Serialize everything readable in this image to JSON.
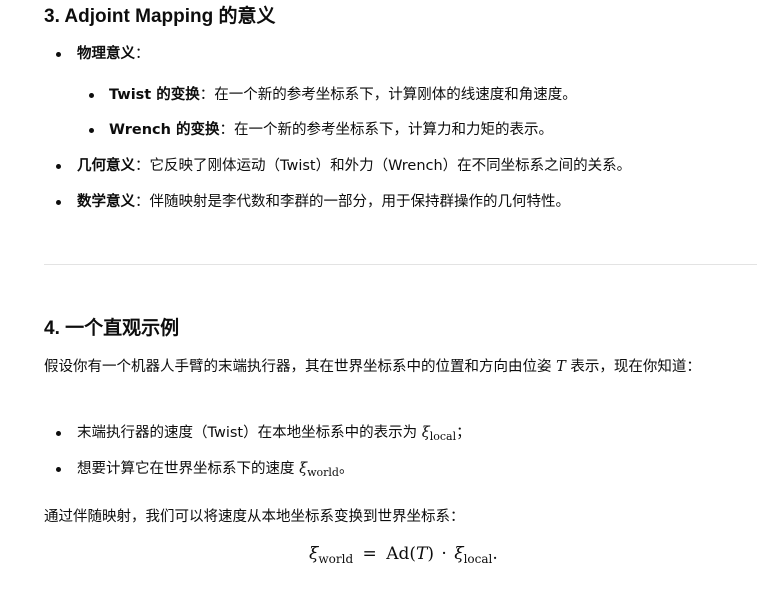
{
  "section3": {
    "heading": "3. Adjoint Mapping 的意义",
    "items": [
      {
        "label": "物理意义",
        "text": "："
      },
      {
        "label": "Twist 的变换",
        "text": "：在一个新的参考坐标系下，计算刚体的线速度和角速度。"
      },
      {
        "label": "Wrench 的变换",
        "text": "：在一个新的参考坐标系下，计算力和力矩的表示。"
      },
      {
        "label": "几何意义",
        "text": "：它反映了刚体运动（Twist）和外力（Wrench）在不同坐标系之间的关系。"
      },
      {
        "label": "数学意义",
        "text": "：伴随映射是李代数和李群的一部分，用于保持群操作的几何特性。"
      }
    ]
  },
  "section4": {
    "heading": "4. 一个直观示例",
    "intro_before": "假设你有一个机器人手臂的末端执行器，其在世界坐标系中的位置和方向由位姿 ",
    "intro_var": "T",
    "intro_after": " 表示，现在你知道：",
    "bullets": [
      {
        "text": "末端执行器的速度（Twist）在本地坐标系中的表示为 ",
        "sym": "ξ",
        "sub": "local",
        "end": "；"
      },
      {
        "text": "想要计算它在世界坐标系下的速度 ",
        "sym": "ξ",
        "sub": "world",
        "end": "。"
      }
    ],
    "conclusion": "通过伴随映射，我们可以将速度从本地坐标系变换到世界坐标系：",
    "equation": {
      "lhs_sym": "ξ",
      "lhs_sub": "world",
      "eq": "=",
      "op": "Ad",
      "arg_open": "(",
      "arg": "T",
      "arg_close": ")",
      "dot": "·",
      "rhs_sym": "ξ",
      "rhs_sub": "local",
      "end": "."
    }
  }
}
